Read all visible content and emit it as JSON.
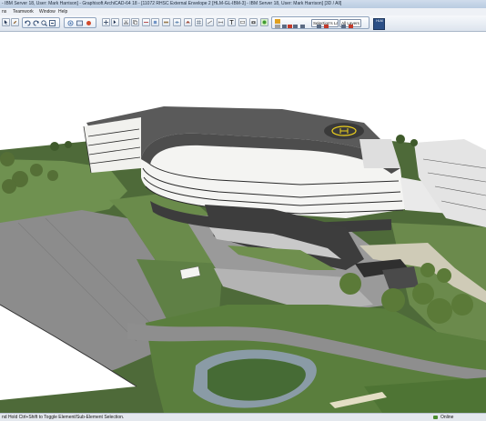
{
  "window": {
    "title": "- IBM Server 18, User: Mark Harrison] - Graphisoft ArchiCAD-64 18 - [11072 RHSC External Envelope 2 [HLM-GL-IBM-3] - IBM Server 18, User: Mark Harrison] [3D / All]"
  },
  "menu": {
    "items": [
      "ns",
      "Teamwork",
      "Window",
      "Help"
    ]
  },
  "toolbar": {
    "layer_label": "Selection's Layer",
    "layers_label": "All Layers",
    "active_tool_label": "HLM"
  },
  "status": {
    "hint": "nd Hold Ctrl+Shift to Toggle Element/Sub-Element Selection.",
    "online_label": "Online"
  },
  "colors": {
    "grass": "#5f8045",
    "road": "#8f8f8f",
    "roof": "#5d5d5d",
    "facade": "#f4f4f2",
    "helipad": "#efd21d"
  },
  "icons": [
    "arrow-tool-icon",
    "pencil-icon",
    "undo-icon",
    "redo-icon",
    "zoom-in-icon",
    "zoom-out-icon",
    "orbit-icon",
    "fit-window-icon",
    "layer-icon",
    "render-icon"
  ]
}
